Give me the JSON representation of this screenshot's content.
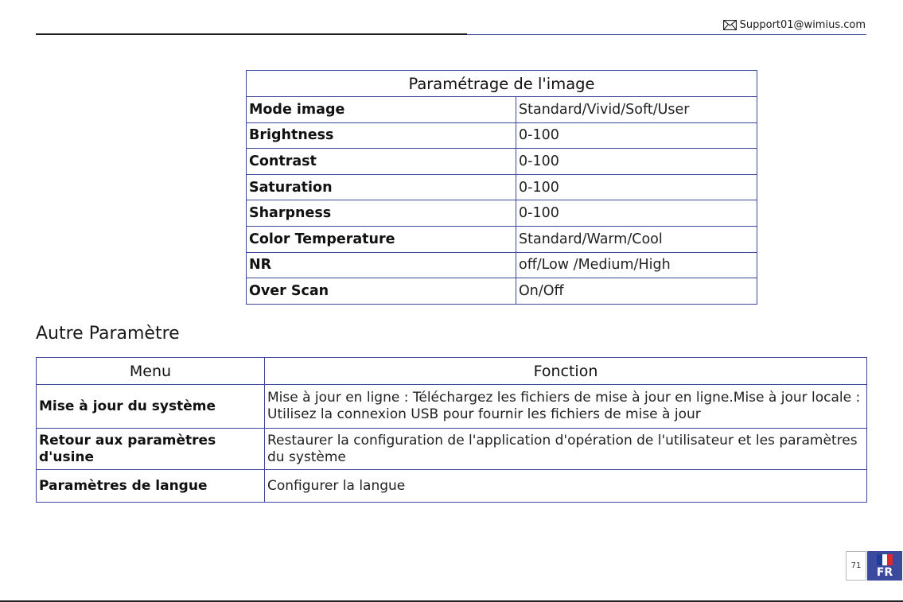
{
  "header": {
    "support_email": "Support01@wimius.com",
    "icon": "envelope-icon"
  },
  "image_settings": {
    "title": "Paramétrage de l'image",
    "rows": [
      {
        "label": "Mode image",
        "value": "Standard/Vivid/Soft/User"
      },
      {
        "label": "Brightness",
        "value": "0-100"
      },
      {
        "label": "Contrast",
        "value": "0-100"
      },
      {
        "label": "Saturation",
        "value": "0-100"
      },
      {
        "label": "Sharpness",
        "value": "0-100"
      },
      {
        "label": "Color Temperature",
        "value": "Standard/Warm/Cool"
      },
      {
        "label": "NR",
        "value": "off/Low /Medium/High"
      },
      {
        "label": "Over Scan",
        "value": "On/Off"
      }
    ]
  },
  "other_settings": {
    "section_title": "Autre Paramètre",
    "headers": {
      "menu": "Menu",
      "function": "Fonction"
    },
    "rows": [
      {
        "menu": "Mise à jour du système",
        "function": "Mise à jour en ligne : Téléchargez les fichiers de mise à jour en ligne.Mise à jour locale : Utilisez la connexion USB pour fournir les fichiers de mise à jour"
      },
      {
        "menu": "Retour aux paramètres d'usine",
        "function": "Restaurer la configuration de l'application d'opération de l'utilisateur et les paramètres du système"
      },
      {
        "menu": "Paramètres de langue",
        "function": "Configurer la langue"
      }
    ]
  },
  "footer": {
    "page_number": "71",
    "language_code": "FR",
    "flag_icon": "france-flag-icon"
  },
  "colors": {
    "accent": "#3b4a9c",
    "flag_blue": "#1f3c99",
    "flag_white": "#ffffff",
    "flag_red": "#e0262e"
  }
}
